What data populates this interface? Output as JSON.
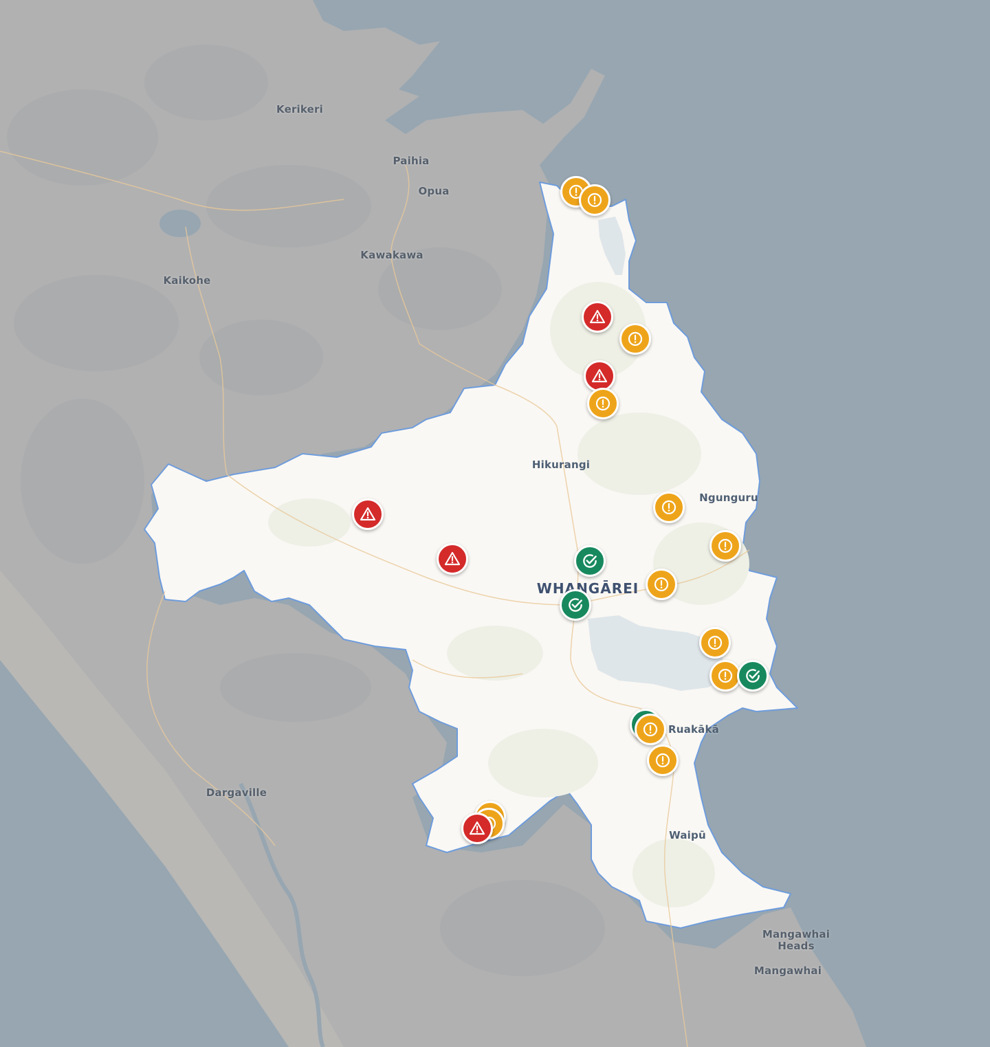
{
  "colors": {
    "sea": "#97a6b1",
    "land": "#b1b1b2",
    "district": "#faf8f4",
    "district_border": "#6e9cdc",
    "alert_red": "#d42a2a",
    "alert_amber": "#eea41a",
    "alert_green": "#18895e"
  },
  "places": [
    {
      "id": "kerikeri",
      "label": "Kerikeri"
    },
    {
      "id": "paihia",
      "label": "Paihia"
    },
    {
      "id": "opua",
      "label": "Opua"
    },
    {
      "id": "kawakawa",
      "label": "Kawakawa"
    },
    {
      "id": "kaikohe",
      "label": "Kaikohe"
    },
    {
      "id": "hikurangi",
      "label": "Hikurangi"
    },
    {
      "id": "ngunguru",
      "label": "Ngunguru"
    },
    {
      "id": "whangarei",
      "label": "WHANGĀREI"
    },
    {
      "id": "ruakaka",
      "label": "Ruakākā"
    },
    {
      "id": "dargaville",
      "label": "Dargaville"
    },
    {
      "id": "waipu",
      "label": "Waipū"
    },
    {
      "id": "mangawhai-heads",
      "label": "Mangawhai Heads"
    },
    {
      "id": "mangawhai",
      "label": "Mangawhai"
    }
  ],
  "marker_icons": {
    "red": "warning-triangle-icon",
    "amber": "exclamation-circle-icon",
    "green": "check-circle-icon"
  },
  "markers": [
    {
      "status": "amber"
    },
    {
      "status": "amber"
    },
    {
      "status": "red"
    },
    {
      "status": "amber"
    },
    {
      "status": "red"
    },
    {
      "status": "amber"
    },
    {
      "status": "red"
    },
    {
      "status": "red"
    },
    {
      "status": "green"
    },
    {
      "status": "green"
    },
    {
      "status": "amber"
    },
    {
      "status": "amber"
    },
    {
      "status": "amber"
    },
    {
      "status": "amber"
    },
    {
      "status": "amber"
    },
    {
      "status": "green"
    },
    {
      "status": "green"
    },
    {
      "status": "amber"
    },
    {
      "status": "amber"
    },
    {
      "status": "amber"
    },
    {
      "status": "amber"
    },
    {
      "status": "red"
    }
  ]
}
